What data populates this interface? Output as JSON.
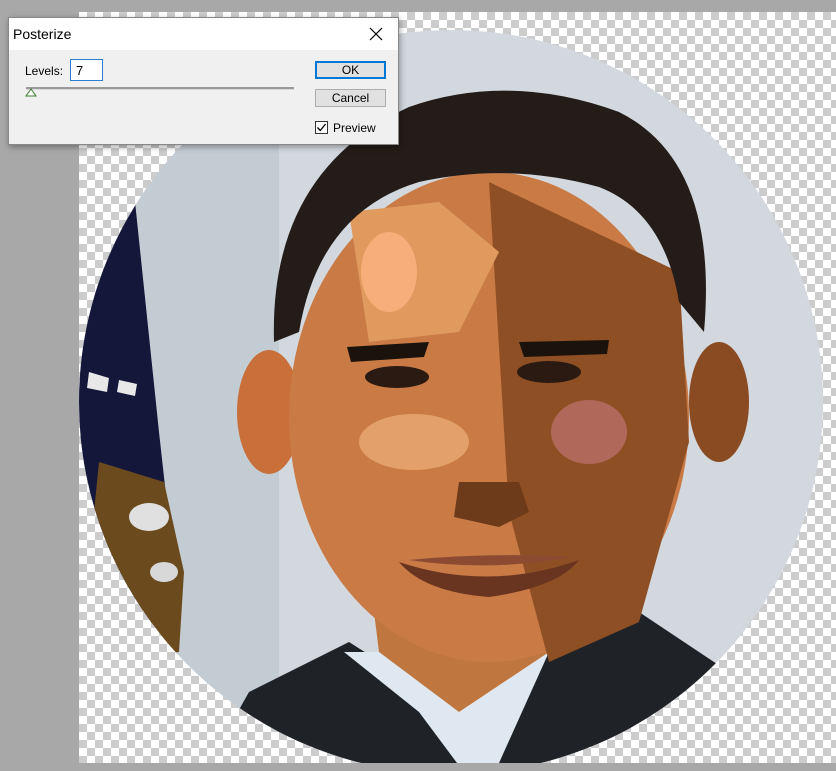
{
  "dialog": {
    "title": "Posterize",
    "levels_label": "Levels:",
    "levels_value": "7",
    "ok_label": "OK",
    "cancel_label": "Cancel",
    "preview_label": "Preview",
    "preview_checked": true,
    "slider_value": 7,
    "icons": {
      "close": "close-icon",
      "slider_thumb": "slider-thumb-icon",
      "checkmark": "checkmark-icon"
    },
    "colors": {
      "accent": "#0078d7",
      "input_border": "#2a7fd4",
      "dialog_bg": "#f0f0f0",
      "titlebar_bg": "#ffffff"
    }
  },
  "canvas": {
    "content": "posterized-portrait-photo",
    "transparency": "checkerboard",
    "colors": {
      "workspace_bg": "#a8a8a8",
      "checker_light": "#ffffff",
      "checker_dark": "#cccccc"
    }
  }
}
